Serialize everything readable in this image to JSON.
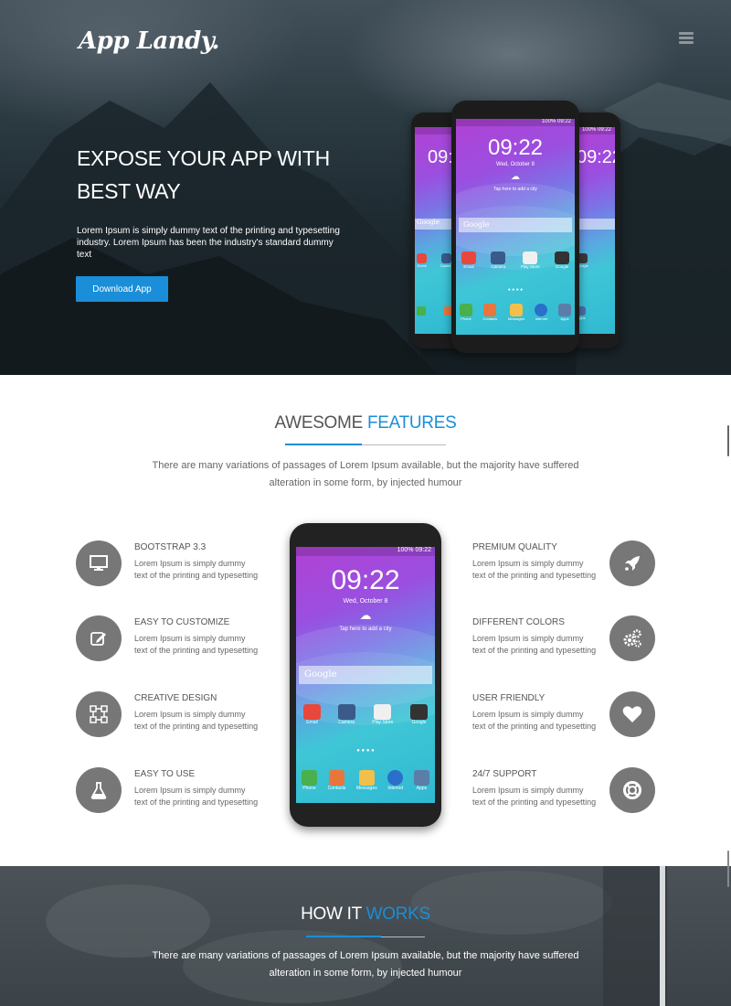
{
  "header": {
    "logo": "App Landy.",
    "menu_icon": "hamburger-icon"
  },
  "hero": {
    "title_line1": "EXPOSE YOUR APP WITH",
    "title_line2": "BEST WAY",
    "text": "Lorem Ipsum is simply dummy text of the printing and typesetting industry. Lorem Ipsum has been the industry's standard dummy text",
    "button": "Download App"
  },
  "phone": {
    "time": "09:22",
    "date": "Wed, October 8",
    "weather": "Tap here to add a city",
    "search": "Google",
    "status": "100% 09:22",
    "apps": [
      "Email",
      "Camera",
      "Play Store",
      "Google"
    ],
    "dock": [
      "Phone",
      "Contacts",
      "Messages",
      "Internet",
      "Apps"
    ],
    "side_apps_left": [
      "Email",
      "Camera"
    ],
    "side_apps_right": [
      "Google",
      "Apps"
    ]
  },
  "features": {
    "title_plain": "AWESOME",
    "title_accent": "FEATURES",
    "sub_line1": "There are many variations of passages of Lorem Ipsum available, but the majority have suffered",
    "sub_line2": "alteration in some form, by injected humour",
    "left": [
      {
        "title": "BOOTSTRAP 3.3",
        "line1": "Lorem Ipsum is simply dummy",
        "line2": "text of the printing and typesetting",
        "icon": "monitor-icon"
      },
      {
        "title": "EASY TO CUSTOMIZE",
        "line1": "Lorem Ipsum is simply dummy",
        "line2": "text of the printing and typesetting",
        "icon": "edit-icon"
      },
      {
        "title": "CREATIVE DESIGN",
        "line1": "Lorem Ipsum is simply dummy",
        "line2": "text of the printing and typesetting",
        "icon": "vector-icon"
      },
      {
        "title": "EASY TO USE",
        "line1": "Lorem Ipsum is simply dummy",
        "line2": "text of the printing and typesetting",
        "icon": "flask-icon"
      }
    ],
    "right": [
      {
        "title": "PREMIUM QUALITY",
        "line1": "Lorem Ipsum is simply dummy",
        "line2": "text of the printing and typesetting",
        "icon": "rocket-icon"
      },
      {
        "title": "DIFFERENT COLORS",
        "line1": "Lorem Ipsum is simply dummy",
        "line2": "text of the printing and typesetting",
        "icon": "gears-icon"
      },
      {
        "title": "USER FRIENDLY",
        "line1": "Lorem Ipsum is simply dummy",
        "line2": "text of the printing and typesetting",
        "icon": "heart-icon"
      },
      {
        "title": "24/7 SUPPORT",
        "line1": "Lorem Ipsum is simply dummy",
        "line2": "text of the printing and typesetting",
        "icon": "lifebuoy-icon"
      }
    ]
  },
  "how": {
    "title_plain": "HOW IT",
    "title_accent": "WORKS",
    "sub_line1": "There are many variations of passages of Lorem Ipsum available, but the majority have suffered",
    "sub_line2": "alteration in some form, by injected humour"
  },
  "colors": {
    "accent": "#1a8ed8",
    "icon_circle": "#777777",
    "heading": "#555555"
  }
}
